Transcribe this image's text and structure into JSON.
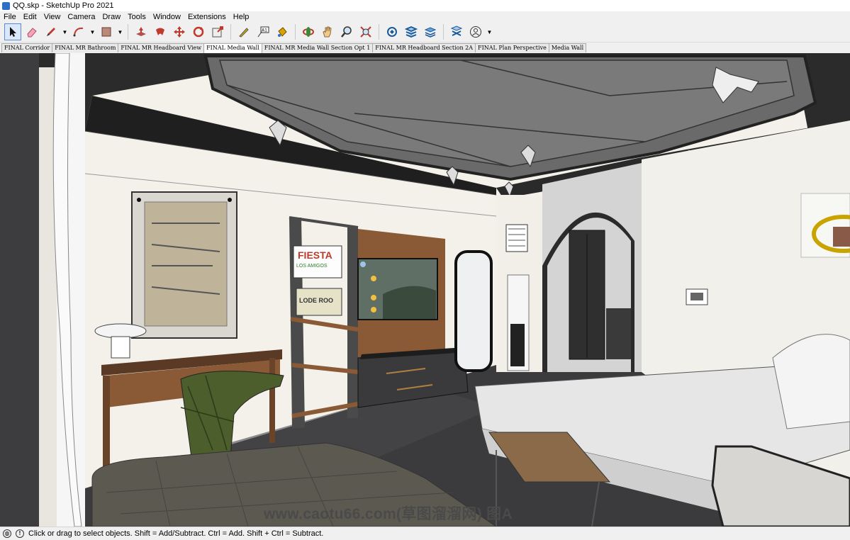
{
  "window": {
    "title": "QQ.skp - SketchUp Pro 2021"
  },
  "menu": [
    "File",
    "Edit",
    "View",
    "Camera",
    "Draw",
    "Tools",
    "Window",
    "Extensions",
    "Help"
  ],
  "toolbar": [
    {
      "name": "select-tool",
      "icon": "arrow-cursor-icon"
    },
    {
      "name": "eraser-tool",
      "icon": "eraser-icon"
    },
    {
      "name": "pencil-line-tool",
      "icon": "pencil-icon"
    },
    {
      "name": "arc-tool",
      "icon": "arc-icon"
    },
    {
      "name": "shape-tool",
      "icon": "rectangle-icon"
    },
    {
      "name": "push-pull-tool",
      "icon": "push-pull-icon"
    },
    {
      "name": "follow-me-tool",
      "icon": "follow-me-icon"
    },
    {
      "name": "move-tool",
      "icon": "move-icon"
    },
    {
      "name": "rotate-tool",
      "icon": "rotate-icon"
    },
    {
      "name": "scale-tool",
      "icon": "scale-icon"
    },
    {
      "name": "tape-measure-tool",
      "icon": "tape-measure-icon"
    },
    {
      "name": "text-tool",
      "icon": "text-icon"
    },
    {
      "name": "paint-bucket-tool",
      "icon": "paint-bucket-icon"
    },
    {
      "name": "orbit-tool",
      "icon": "orbit-icon"
    },
    {
      "name": "pan-tool",
      "icon": "hand-icon"
    },
    {
      "name": "zoom-tool",
      "icon": "zoom-icon"
    },
    {
      "name": "zoom-extents-tool",
      "icon": "zoom-extents-icon"
    },
    {
      "name": "3d-warehouse-tool",
      "icon": "warehouse-icon"
    },
    {
      "name": "extension-warehouse-tool",
      "icon": "extension-warehouse-icon"
    },
    {
      "name": "layout-tool",
      "icon": "layout-icon"
    },
    {
      "name": "extension-manager-tool",
      "icon": "extension-manager-icon"
    },
    {
      "name": "account-tool",
      "icon": "user-account-icon"
    }
  ],
  "scene_tabs": [
    {
      "label": "FINAL Corridor",
      "active": false
    },
    {
      "label": "FINAL MR Bathroom",
      "active": false
    },
    {
      "label": "FINAL MR Headboard View",
      "active": false
    },
    {
      "label": "FINAL Media Wall",
      "active": true
    },
    {
      "label": "FINAL MR Media Wall Section Opt 1",
      "active": false
    },
    {
      "label": "FINAL MR Headboard Section 2A",
      "active": false
    },
    {
      "label": "FINAL Plan Perspective",
      "active": false
    },
    {
      "label": "Media Wall",
      "active": false
    }
  ],
  "scene": {
    "poster_top": "FIESTA",
    "poster_sub": "LOS AMIGOS",
    "poster_bottom": "LODE ROO",
    "watermark": "www.caotu66.com(草图溜溜网) 图A"
  },
  "status": {
    "text": "Click or drag to select objects. Shift = Add/Subtract. Ctrl = Add. Shift + Ctrl = Subtract."
  },
  "colors": {
    "wood": "#8a5a36",
    "ceiling_dark": "#2b2b2b",
    "wall": "#f3f1ea",
    "chair_green": "#4b5e2c"
  }
}
